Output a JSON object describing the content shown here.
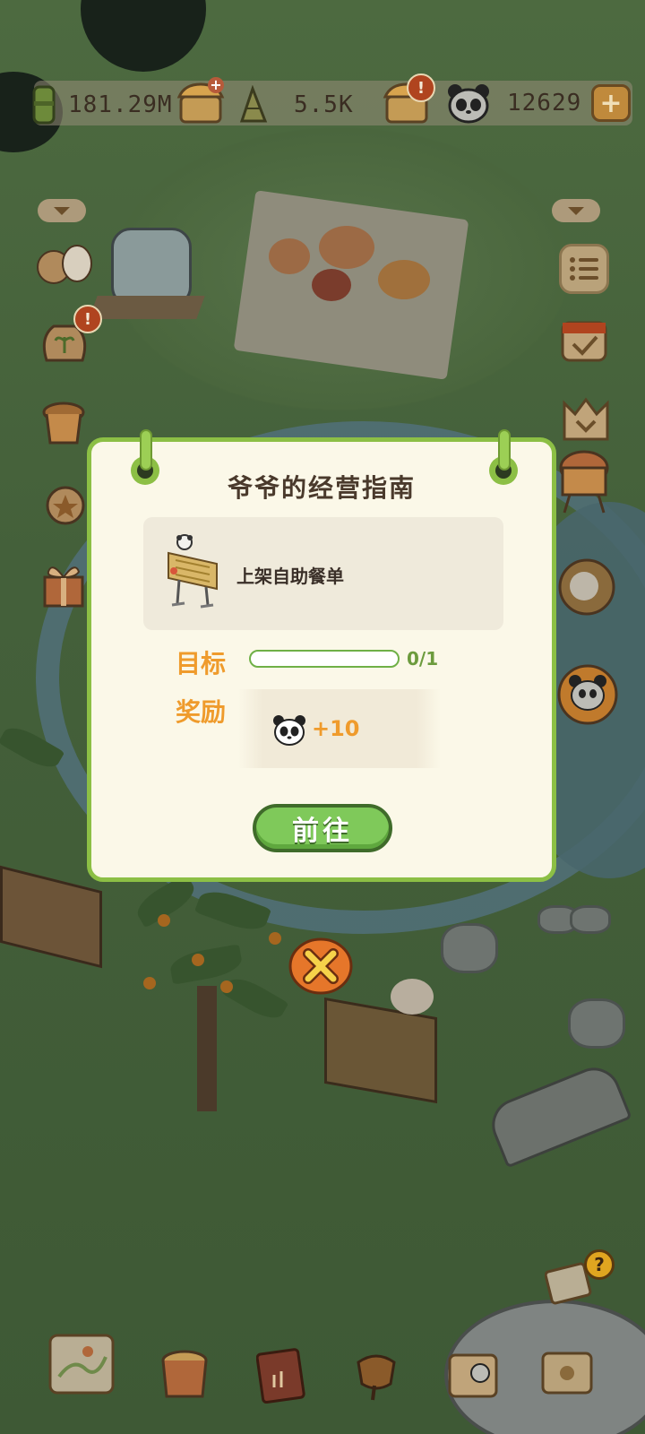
{
  "resources": {
    "bamboo_value": "181.29M",
    "shoot_value": "5.5K",
    "panda_value": "12629",
    "add_symbol": "+"
  },
  "badges": {
    "alert": "!",
    "help": "?"
  },
  "dialog": {
    "title": "爷爷的经营指南",
    "task_text": "上架自助餐单",
    "target_label": "目标",
    "progress_text": "0/1",
    "progress_fraction": 0,
    "reward_label": "奖励",
    "reward_value": "+10",
    "go_button": "前往"
  },
  "colors": {
    "accent_green": "#8cbf45",
    "reward_orange": "#ef9b2c",
    "dialog_bg": "#fbf8e8",
    "close_orange": "#e6762a"
  }
}
